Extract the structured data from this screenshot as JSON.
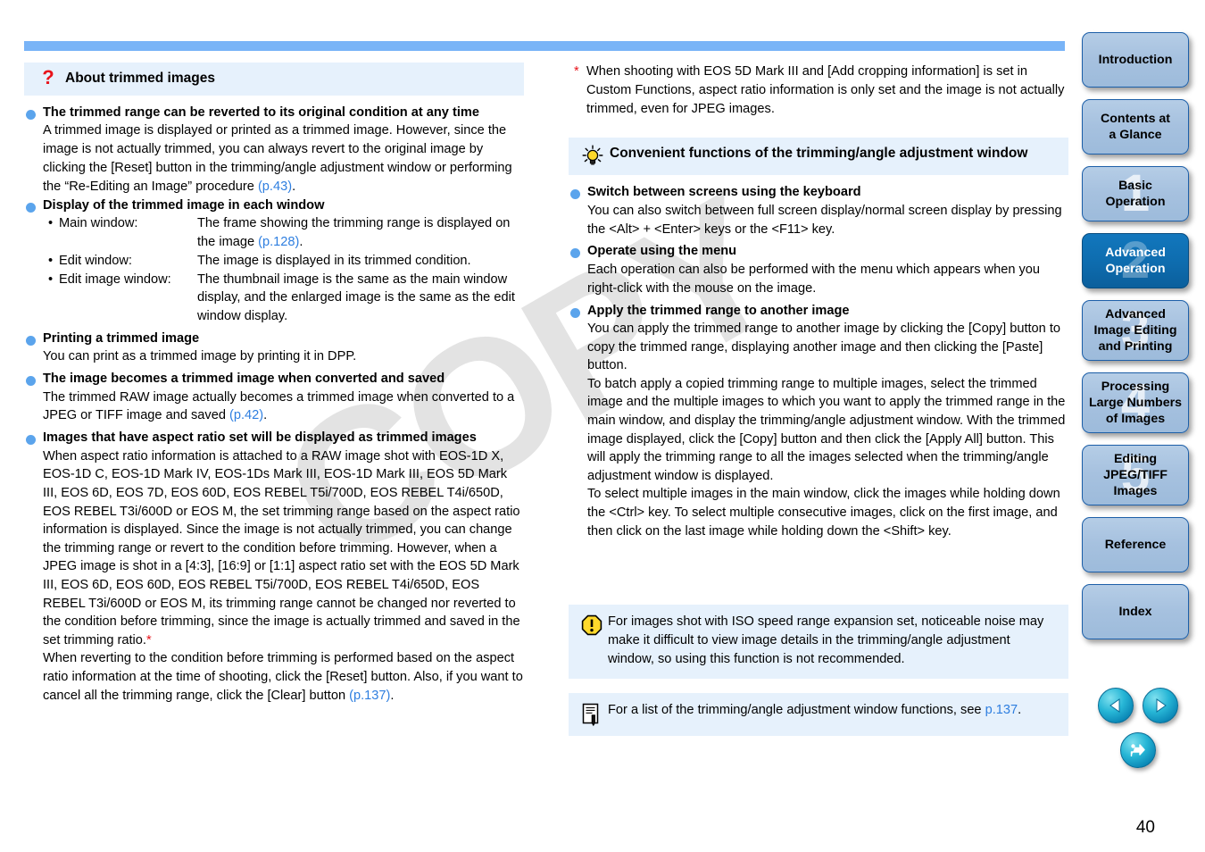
{
  "page": {
    "number": "40",
    "watermark_text": "COPY",
    "accent_rule_color": "#79b4f7",
    "infobox_bg_color": "#e6f1fc",
    "bullet_color": "#5ba4ec",
    "link_color": "#2f7fe0",
    "active_tab_color": "#0e6cae"
  },
  "left_column": {
    "section": {
      "icon": "question-mark-icon",
      "title": "About trimmed images"
    },
    "items": [
      {
        "heading": "The trimmed range can be reverted to its original condition at any time",
        "body_pre": "A trimmed image is displayed or printed as a trimmed image. However, since the image is not actually trimmed, you can always revert to the original image by clicking the [Reset] button in the trimming/angle adjustment window or performing the “Re-Editing an Image” procedure ",
        "body_link": "(p.43)",
        "body_post": "."
      },
      {
        "heading": "Display of the trimmed image in each window",
        "defs": [
          {
            "term": "Main window:",
            "desc_pre": "The frame showing the trimming range is displayed on the image ",
            "desc_link": "(p.128)",
            "desc_post": "."
          },
          {
            "term": "Edit window:",
            "desc_pre": "The image is displayed in its trimmed condition.",
            "desc_link": "",
            "desc_post": ""
          },
          {
            "term": "Edit image window:",
            "desc_pre": "The thumbnail image is the same as the main window display, and the enlarged image is the same as the edit window display.",
            "desc_link": "",
            "desc_post": ""
          }
        ]
      },
      {
        "heading": "Printing a trimmed image",
        "body_pre": "You can print as a trimmed image by printing it in DPP.",
        "body_link": "",
        "body_post": ""
      },
      {
        "heading": "The image becomes a trimmed image when converted and saved",
        "body_pre": "The trimmed RAW image actually becomes a trimmed image when converted to a JPEG or TIFF image and saved ",
        "body_link": "(p.42)",
        "body_post": "."
      },
      {
        "heading": "Images that have aspect ratio set will be displayed as trimmed images",
        "body_pre": "When aspect ratio information is attached to a RAW image shot with EOS-1D X, EOS-1D C, EOS-1D Mark IV, EOS-1Ds Mark III, EOS-1D Mark III, EOS 5D Mark III, EOS 6D, EOS 7D, EOS 60D, EOS REBEL T5i/700D, EOS REBEL T4i/650D, EOS REBEL T3i/600D or EOS M, the set trimming range based on the aspect ratio information is displayed. Since the image is not actually trimmed, you can change the trimming range or revert to the condition before trimming. However, when a JPEG image is shot in a [4:3], [16:9] or [1:1] aspect ratio set with the EOS 5D Mark III, EOS 6D, EOS 60D, EOS REBEL T5i/700D, EOS REBEL T4i/650D, EOS REBEL T3i/600D or EOS M, its trimming range cannot be changed nor reverted to the condition before trimming, since the image is actually trimmed and saved in the set trimming ratio.",
        "body_asterisk": "*",
        "body_para2_pre": "When reverting to the condition before trimming is performed based on the aspect ratio information at the time of shooting, click the [Reset] button. Also, if you want to cancel all the trimming range, click the [Clear] button ",
        "body_para2_link": "(p.137)",
        "body_para2_post": "."
      }
    ]
  },
  "right_column": {
    "footnote": {
      "marker": "*",
      "text": "When shooting with EOS 5D Mark III and [Add cropping information] is set in Custom Functions, aspect ratio information is only set and the image is not actually trimmed, even for JPEG images."
    },
    "section": {
      "icon": "lightbulb-icon",
      "title": "Convenient functions of the trimming/angle adjustment window"
    },
    "items": [
      {
        "heading": "Switch between screens using the keyboard",
        "body": "You can also switch between full screen display/normal screen display by pressing the <Alt> + <Enter> keys or the <F11> key."
      },
      {
        "heading": "Operate using the menu",
        "body": "Each operation can also be performed with the menu which appears when you right-click with the mouse on the image."
      },
      {
        "heading": "Apply the trimmed range to another image",
        "body": "You can apply the trimmed range to another image by clicking the [Copy] button to copy the trimmed range, displaying another image and then clicking the [Paste] button.\nTo batch apply a copied trimming range to multiple images, select the trimmed image and the multiple images to which you want to apply the trimmed range in the main window, and display the trimming/angle adjustment window. With the trimmed image displayed, click the [Copy] button and then click the [Apply All] button. This will apply the trimming range to all the images selected when the trimming/angle adjustment window is displayed.\nTo select multiple images in the main window, click the images while holding down the <Ctrl> key. To select multiple consecutive images, click on the first image, and then click on the last image while holding down the <Shift> key."
      }
    ],
    "caution_box": {
      "icon": "warning-icon",
      "text": "For images shot with ISO speed range expansion set, noticeable noise may make it difficult to view image details in the trimming/angle adjustment window, so using this function is not recommended."
    },
    "note_box": {
      "icon": "note-icon",
      "text_pre": "For a list of the trimming/angle adjustment window functions, see ",
      "text_link": "p.137",
      "text_post": "."
    }
  },
  "sidebar": {
    "tabs": [
      {
        "label": "Introduction",
        "number": "",
        "active": false,
        "lines": 1
      },
      {
        "label": "Contents at\na Glance",
        "number": "",
        "active": false,
        "lines": 2
      },
      {
        "label": "Basic\nOperation",
        "number": "1",
        "active": false,
        "lines": 2
      },
      {
        "label": "Advanced\nOperation",
        "number": "2",
        "active": true,
        "lines": 2
      },
      {
        "label": "Advanced\nImage Editing\nand Printing",
        "number": "3",
        "active": false,
        "lines": 3
      },
      {
        "label": "Processing\nLarge Numbers\nof Images",
        "number": "4",
        "active": false,
        "lines": 3
      },
      {
        "label": "Editing\nJPEG/TIFF\nImages",
        "number": "5",
        "active": false,
        "lines": 3
      },
      {
        "label": "Reference",
        "number": "",
        "active": false,
        "lines": 1
      },
      {
        "label": "Index",
        "number": "",
        "active": false,
        "lines": 1
      }
    ]
  },
  "nav_buttons": [
    {
      "name": "previous-page-button",
      "icon": "triangle-left-icon"
    },
    {
      "name": "next-page-button",
      "icon": "triangle-right-icon"
    },
    {
      "name": "return-button",
      "icon": "return-arrow-icon"
    }
  ]
}
